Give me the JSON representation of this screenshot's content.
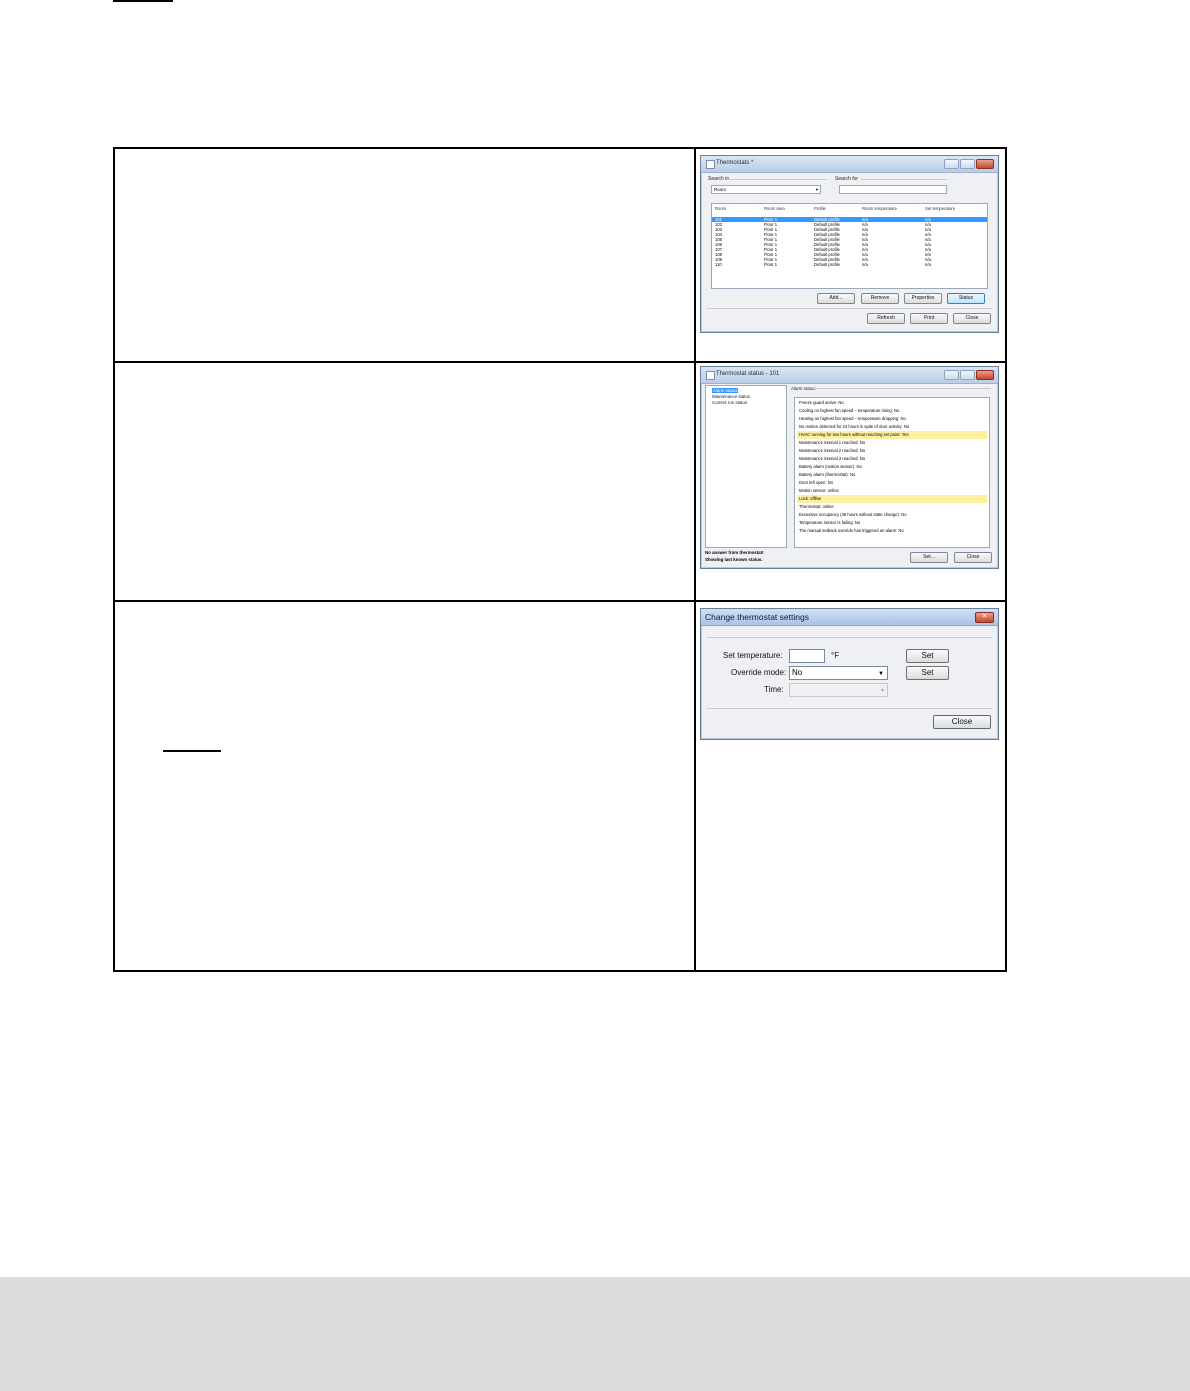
{
  "thermostats_window": {
    "title": "Thermostats *",
    "search_in_label": "Search in",
    "search_in_value": "Room",
    "search_for_label": "Search for",
    "columns": [
      "Room",
      "Room area",
      "Profile",
      "Room temperature",
      "Set temperature"
    ],
    "rows": [
      [
        "101",
        "Floor 1",
        "Default profile",
        "n/a",
        "n/a"
      ],
      [
        "102",
        "Floor 1",
        "Default profile",
        "n/a",
        "n/a"
      ],
      [
        "103",
        "Floor 1",
        "Default profile",
        "n/a",
        "n/a"
      ],
      [
        "104",
        "Floor 1",
        "Default profile",
        "n/a",
        "n/a"
      ],
      [
        "105",
        "Floor 1",
        "Default profile",
        "n/a",
        "n/a"
      ],
      [
        "106",
        "Floor 1",
        "Default profile",
        "n/a",
        "n/a"
      ],
      [
        "107",
        "Floor 1",
        "Default profile",
        "n/a",
        "n/a"
      ],
      [
        "108",
        "Floor 1",
        "Default profile",
        "n/a",
        "n/a"
      ],
      [
        "109",
        "Floor 1",
        "Default profile",
        "n/a",
        "n/a"
      ],
      [
        "110",
        "Floor 1",
        "Default profile",
        "n/a",
        "n/a"
      ]
    ],
    "buttons": {
      "add": "Add...",
      "remove": "Remove",
      "properties": "Properties",
      "status": "Status",
      "refresh": "Refresh",
      "print": "Print",
      "close": "Close"
    }
  },
  "status_window": {
    "title": "Thermostat status - 101",
    "tree": [
      "Alarm status",
      "Maintenance status",
      "Current run status"
    ],
    "group_label": "Alarm status",
    "alarms": [
      {
        "text": "Freeze guard active: No",
        "highlight": false
      },
      {
        "text": "Cooling on highest fan speed – temperature rising: No",
        "highlight": false
      },
      {
        "text": "Heating on highest fan speed – temperature dropping: No",
        "highlight": false
      },
      {
        "text": "No motion detected for 24 hours in spite of door activity: No",
        "highlight": false
      },
      {
        "text": "HVAC running for two hours without reaching set point: Yes",
        "highlight": true
      },
      {
        "text": "Maintenance interval 1 reached: No",
        "highlight": false
      },
      {
        "text": "Maintenance interval 2 reached: No",
        "highlight": false
      },
      {
        "text": "Maintenance interval 3 reached: No",
        "highlight": false
      },
      {
        "text": "Battery alarm (motion sensor): No",
        "highlight": false
      },
      {
        "text": "Battery alarm (thermostat): No",
        "highlight": false
      },
      {
        "text": "Door left open: No",
        "highlight": false
      },
      {
        "text": "Motion sensor: online",
        "highlight": false
      },
      {
        "text": "Lock: offline",
        "highlight": true
      },
      {
        "text": "Thermostat: online",
        "highlight": false
      },
      {
        "text": "Excessive occupancy (48 hours without state change): No",
        "highlight": false
      },
      {
        "text": "Temperature sensor is failing: No",
        "highlight": false
      },
      {
        "text": "The manual setback override has triggered an alarm: No",
        "highlight": false
      }
    ],
    "note_line1": "No answer from thermostat!",
    "note_line2": "Showing last known status.",
    "buttons": {
      "set": "Set...",
      "close": "Close"
    }
  },
  "settings_window": {
    "title": "Change thermostat settings",
    "close_glyph": "✕",
    "set_temperature_label": "Set temperature:",
    "unit": "°F",
    "override_mode_label": "Override mode:",
    "override_mode_value": "No",
    "time_label": "Time:",
    "buttons": {
      "set": "Set",
      "close": "Close"
    }
  },
  "colors": {
    "selection": "#3399ff",
    "highlight": "#fdf0a0",
    "footer": "#dcdcdd"
  }
}
